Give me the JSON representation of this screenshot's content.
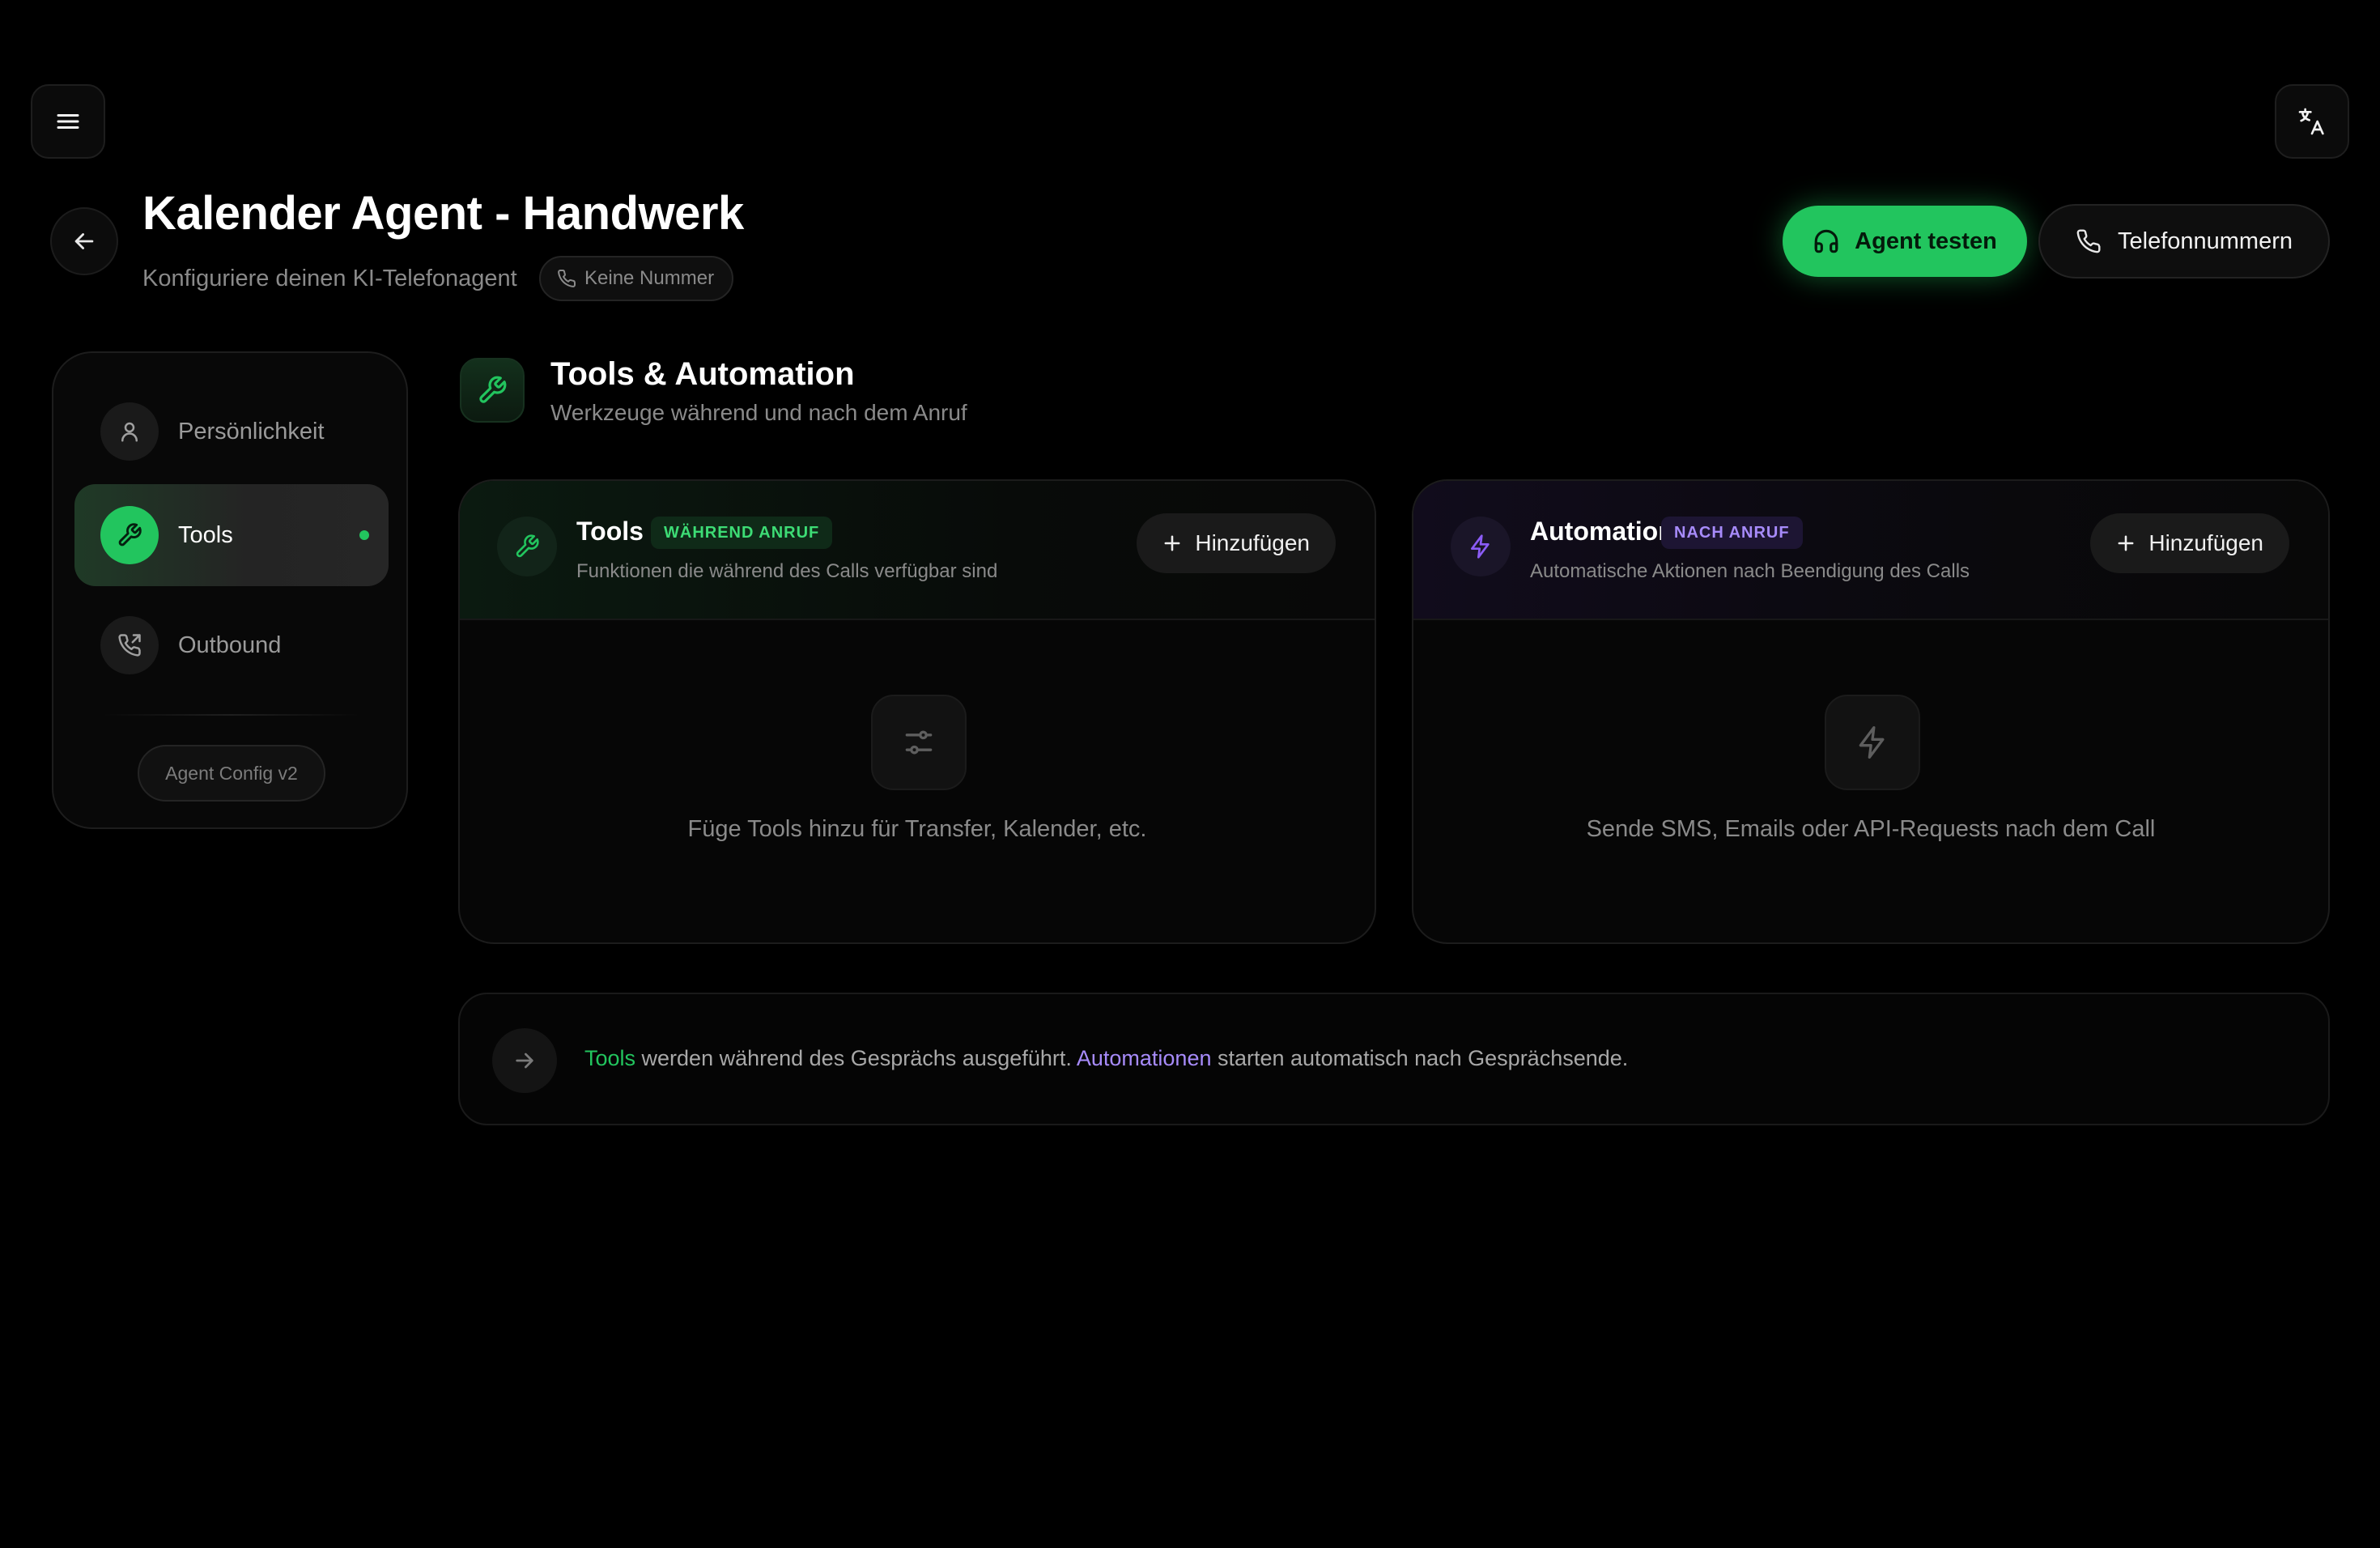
{
  "header": {
    "title": "Kalender Agent - Handwerk",
    "subtitle": "Konfiguriere deinen KI-Telefonagent",
    "number_chip": "Keine Nummer",
    "test_button": "Agent testen",
    "phones_button": "Telefonnummern"
  },
  "sidebar": {
    "items": [
      {
        "label": "Persönlichkeit",
        "icon": "user-icon",
        "active": false
      },
      {
        "label": "Tools",
        "icon": "wrench-icon",
        "active": true
      },
      {
        "label": "Outbound",
        "icon": "phone-outgoing-icon",
        "active": false
      }
    ],
    "version": "Agent Config v2"
  },
  "section": {
    "title": "Tools & Automation",
    "subtitle": "Werkzeuge während und nach dem Anruf"
  },
  "cards": {
    "tools": {
      "title": "Tools",
      "badge": "WÄHREND ANRUF",
      "description": "Funktionen die während des Calls verfügbar sind",
      "add_label": "Hinzufügen",
      "empty_text": "Füge Tools hinzu für Transfer, Kalender, etc."
    },
    "automation": {
      "title": "Automation",
      "badge": "NACH ANRUF",
      "description": "Automatische Aktionen nach Beendigung des Calls",
      "add_label": "Hinzufügen",
      "empty_text": "Sende SMS, Emails oder API-Requests nach dem Call"
    }
  },
  "info": {
    "tools_word": "Tools",
    "middle": " werden während des Gesprächs ausgeführt. ",
    "automation_word": "Automationen",
    "end": " starten automatisch nach Gesprächsende."
  },
  "colors": {
    "accent_green": "#22c55e",
    "accent_purple": "#a78bfa",
    "background": "#000000"
  }
}
